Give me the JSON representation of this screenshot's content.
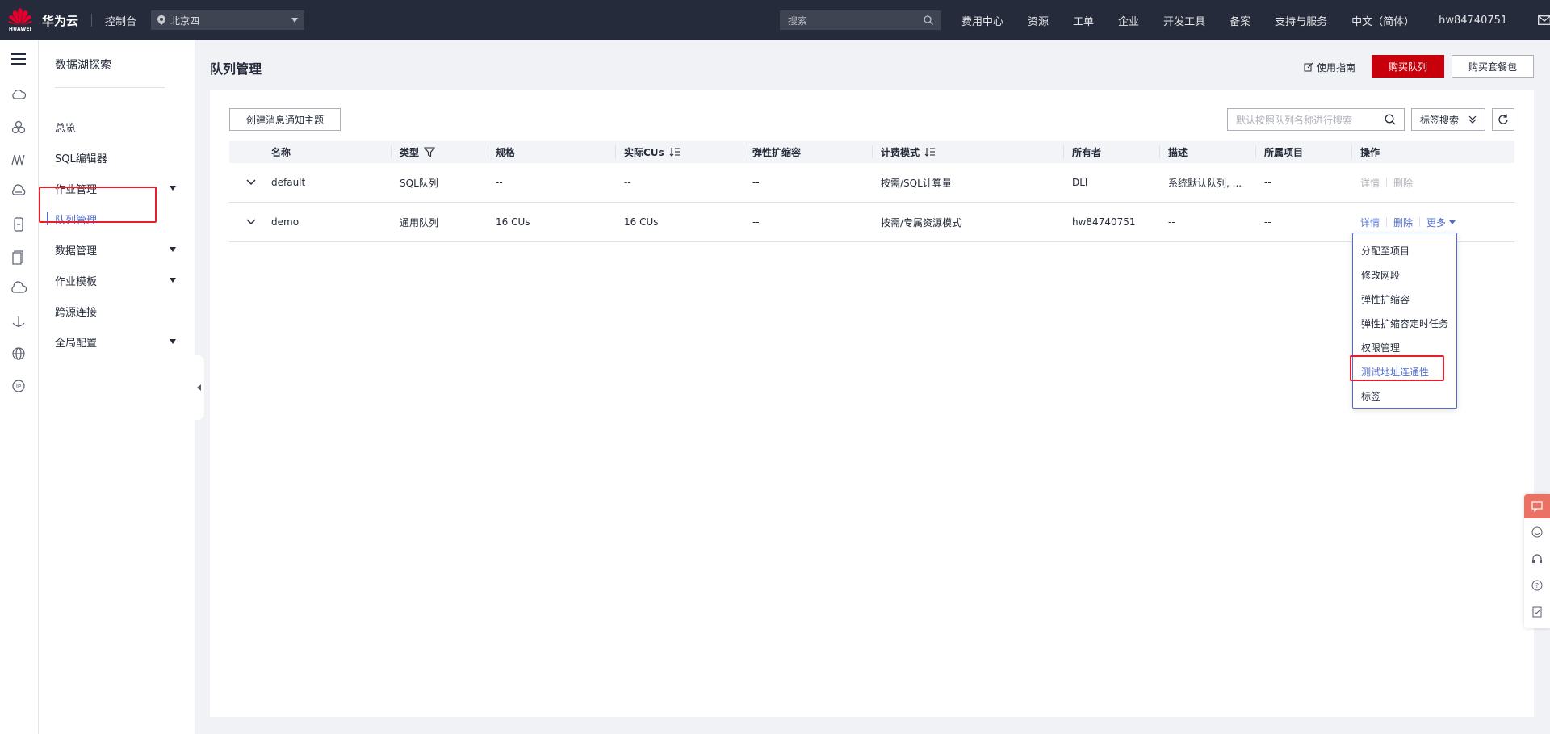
{
  "topbar": {
    "logo_word": "HUAWEI",
    "brand": "华为云",
    "console": "控制台",
    "region": "北京四",
    "search_placeholder": "搜索",
    "nav": [
      "费用中心",
      "资源",
      "工单",
      "企业",
      "开发工具",
      "备案",
      "支持与服务",
      "中文（简体）"
    ],
    "user": "hw84740751"
  },
  "sidebar": {
    "title": "数据湖探索",
    "items": [
      {
        "label": "总览",
        "has_sub": false
      },
      {
        "label": "SQL编辑器",
        "has_sub": false
      },
      {
        "label": "作业管理",
        "has_sub": true
      },
      {
        "label": "队列管理",
        "has_sub": false,
        "active": true
      },
      {
        "label": "数据管理",
        "has_sub": true
      },
      {
        "label": "作业模板",
        "has_sub": true
      },
      {
        "label": "跨源连接",
        "has_sub": false
      },
      {
        "label": "全局配置",
        "has_sub": true
      }
    ]
  },
  "page": {
    "title": "队列管理",
    "guide": "使用指南",
    "buy_queue": "购买队列",
    "buy_package": "购买套餐包",
    "create_topic": "创建消息通知主题",
    "search_placeholder": "默认按照队列名称进行搜索",
    "tag_search": "标签搜索"
  },
  "table": {
    "headers": [
      "名称",
      "类型",
      "规格",
      "实际CUs",
      "弹性扩缩容",
      "计费模式",
      "所有者",
      "描述",
      "所属项目",
      "操作"
    ],
    "rows": [
      {
        "name": "default",
        "type": "SQL队列",
        "spec": "--",
        "cus": "--",
        "elastic": "--",
        "billing": "按需/SQL计算量",
        "owner": "DLI",
        "desc": "系统默认队列, ...",
        "project": "--",
        "ops": [
          "详情",
          "删除"
        ]
      },
      {
        "name": "demo",
        "type": "通用队列",
        "spec": "16 CUs",
        "cus": "16 CUs",
        "elastic": "--",
        "billing": "按需/专属资源模式",
        "owner": "hw84740751",
        "desc": "--",
        "project": "--",
        "ops": [
          "详情",
          "删除",
          "更多"
        ]
      }
    ]
  },
  "dropdown": {
    "items": [
      "分配至项目",
      "修改网段",
      "弹性扩缩容",
      "弹性扩缩容定时任务",
      "权限管理",
      "测试地址连通性",
      "标签"
    ]
  },
  "colors": {
    "topbar": "#252b3a",
    "brand_red": "#c7000b",
    "link_blue": "#526ecc",
    "highlight_red": "#e5202d"
  }
}
